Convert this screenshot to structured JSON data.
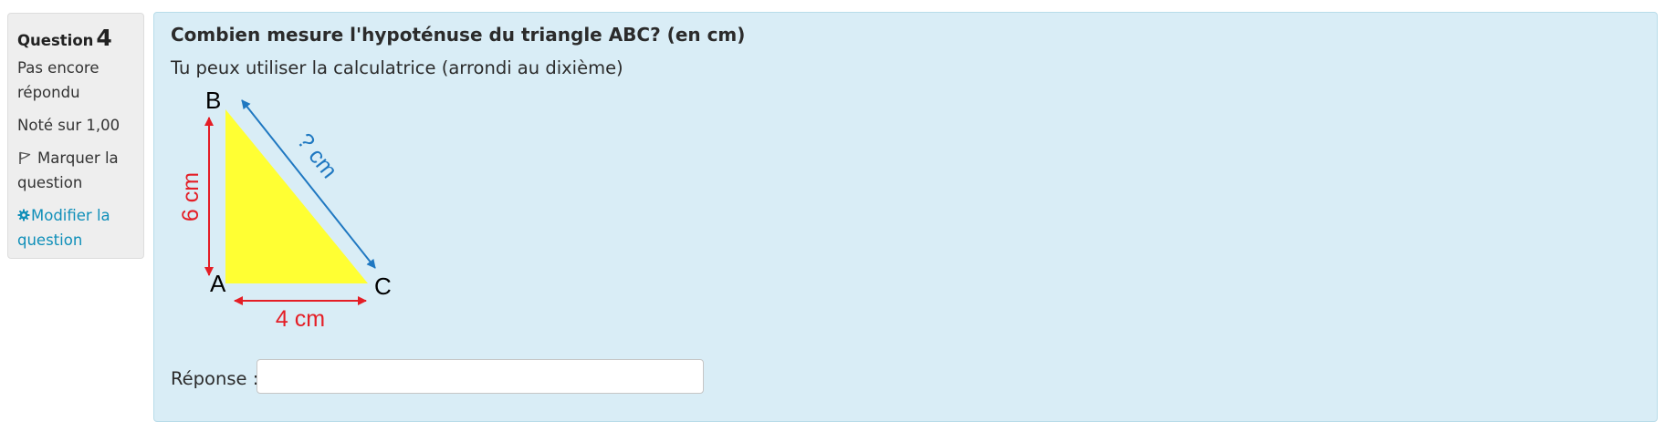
{
  "info": {
    "question_label": "Question",
    "question_number": "4",
    "status": "Pas encore répondu",
    "grade": "Noté sur 1,00",
    "flag_label": "Marquer la question",
    "edit_label": "Modifier la question"
  },
  "question": {
    "title": "Combien mesure l'hypoténuse du triangle ABC? (en cm)",
    "hint": "Tu peux utiliser la calculatrice (arrondi au dixième)"
  },
  "figure": {
    "vertex_a": "A",
    "vertex_b": "B",
    "vertex_c": "C",
    "side_ab": "6 cm",
    "side_ac": "4 cm",
    "side_bc": "? cm",
    "colors": {
      "triangle_fill": "#ffff33",
      "known_sides": "#e41e26",
      "hypotenuse": "#1f78c1"
    }
  },
  "answer": {
    "label": "Réponse :",
    "value": "",
    "placeholder": ""
  },
  "colors": {
    "content_bg": "#d9edf6",
    "info_bg": "#eeeeee",
    "link": "#0f8fb9"
  }
}
